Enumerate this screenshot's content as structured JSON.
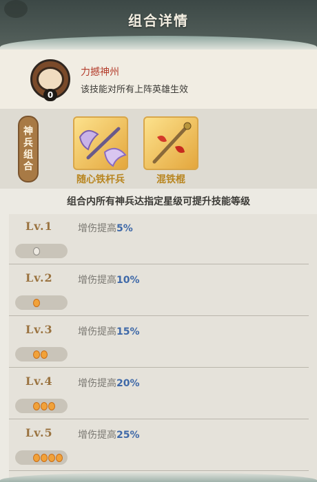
{
  "header": {
    "title": "组合详情"
  },
  "skill": {
    "name": "力撼神州",
    "description": "该技能对所有上阵英雄生效",
    "badge": "0"
  },
  "combo": {
    "tag_chars": [
      "神",
      "兵",
      "组",
      "合"
    ],
    "weapons": [
      {
        "name": "随心铁杆兵",
        "icon": "axe-weapon-icon"
      },
      {
        "name": "混铁棍",
        "icon": "staff-weapon-icon"
      }
    ]
  },
  "note": "组合内所有神兵达指定星级可提升技能等级",
  "levels": [
    {
      "label": "Lv.1",
      "bonus_prefix": "增伤提高",
      "bonus_value": "5%",
      "stars": 0
    },
    {
      "label": "Lv.2",
      "bonus_prefix": "增伤提高",
      "bonus_value": "10%",
      "stars": 1
    },
    {
      "label": "Lv.3",
      "bonus_prefix": "增伤提高",
      "bonus_value": "15%",
      "stars": 2
    },
    {
      "label": "Lv.4",
      "bonus_prefix": "增伤提高",
      "bonus_value": "20%",
      "stars": 3
    },
    {
      "label": "Lv.5",
      "bonus_prefix": "增伤提高",
      "bonus_value": "25%",
      "stars": 4
    }
  ],
  "colors": {
    "accent_orange": "#f1a23a",
    "value_blue": "#3f69a8",
    "skill_red": "#b43c2b",
    "weapon_gold": "#b8851f"
  }
}
